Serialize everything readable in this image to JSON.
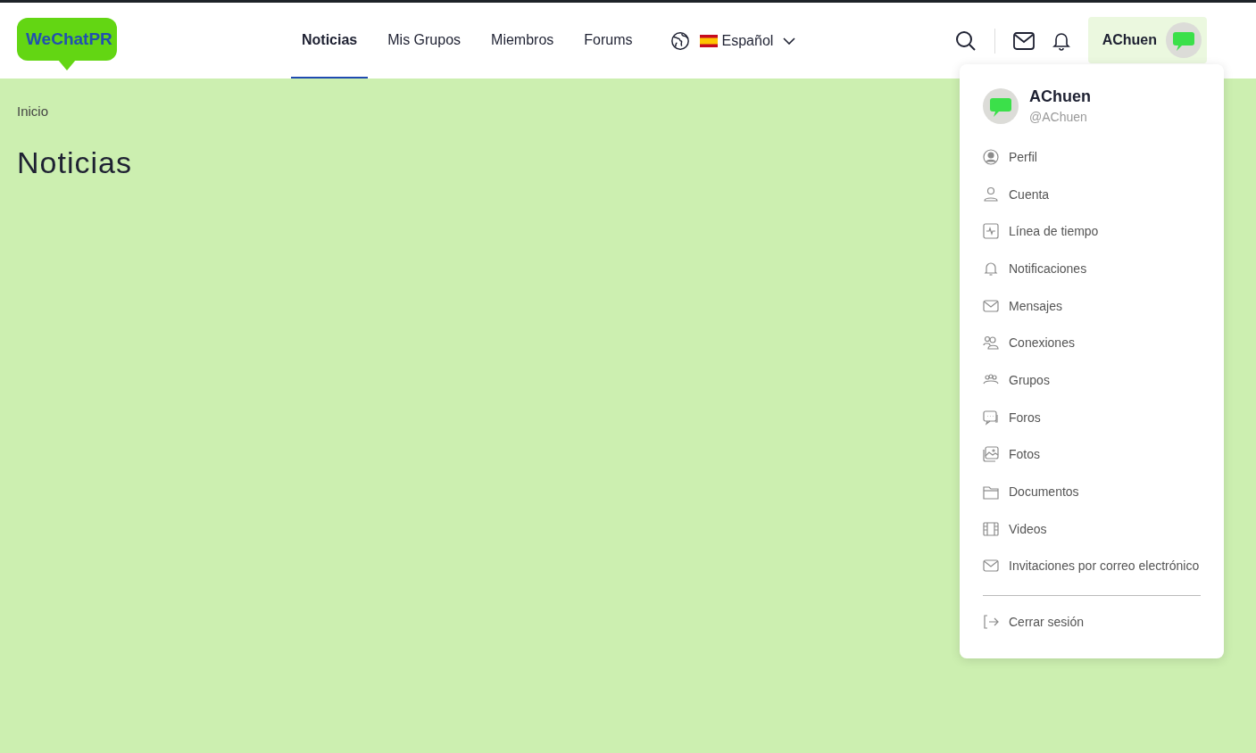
{
  "header": {
    "logo": "WeChatPR",
    "nav": [
      {
        "label": "Noticias",
        "selected": true
      },
      {
        "label": "Mis Grupos",
        "selected": false
      },
      {
        "label": "Miembros",
        "selected": false
      },
      {
        "label": "Forums",
        "selected": false
      }
    ],
    "language": "Español",
    "user_name": "AChuen"
  },
  "breadcrumb": "Inicio",
  "page_title": "Noticias",
  "user_menu": {
    "name": "AChuen",
    "handle": "@AChuen",
    "items": [
      {
        "label": "Perfil"
      },
      {
        "label": "Cuenta"
      },
      {
        "label": "Línea de tiempo"
      },
      {
        "label": "Notificaciones"
      },
      {
        "label": "Mensajes"
      },
      {
        "label": "Conexiones"
      },
      {
        "label": "Grupos"
      },
      {
        "label": "Foros"
      },
      {
        "label": "Fotos"
      },
      {
        "label": "Documentos"
      },
      {
        "label": "Videos"
      },
      {
        "label": "Invitaciones por correo electrónico"
      }
    ],
    "logout": "Cerrar sesión"
  }
}
